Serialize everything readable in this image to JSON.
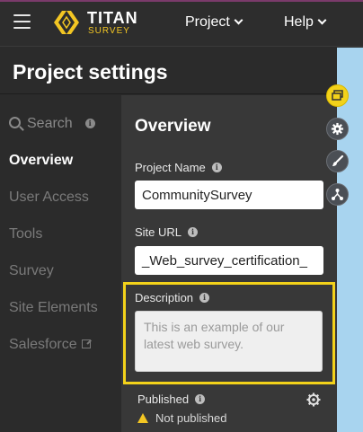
{
  "header": {
    "brand_name": "TITAN",
    "brand_sub": "SURVEY",
    "nav_project": "Project",
    "nav_help": "Help"
  },
  "page": {
    "title": "Project settings"
  },
  "sidebar": {
    "search_label": "Search",
    "items": [
      {
        "label": "Overview",
        "active": true
      },
      {
        "label": "User Access"
      },
      {
        "label": "Tools"
      },
      {
        "label": "Survey"
      },
      {
        "label": "Site Elements"
      },
      {
        "label": "Salesforce"
      }
    ]
  },
  "overview": {
    "title": "Overview",
    "project_name_label": "Project Name",
    "project_name_value": "CommunitySurvey",
    "site_url_label": "Site URL",
    "site_url_value": "_Web_survey_certification_",
    "description_label": "Description",
    "description_placeholder": "This is an example of our latest web survey.",
    "published_label": "Published",
    "published_status": "Not published"
  },
  "colors": {
    "accent_yellow": "#f3d21a",
    "blue_strip": "#a8d4ef",
    "background": "#2b2b2b",
    "panel": "#383838"
  },
  "icons": [
    "menu-icon",
    "titan-logo-icon",
    "search-icon",
    "info-icon",
    "external-link-icon",
    "layers-icon",
    "settings-icon",
    "paint-brush-icon",
    "hierarchy-icon",
    "gear-icon",
    "warning-icon"
  ]
}
